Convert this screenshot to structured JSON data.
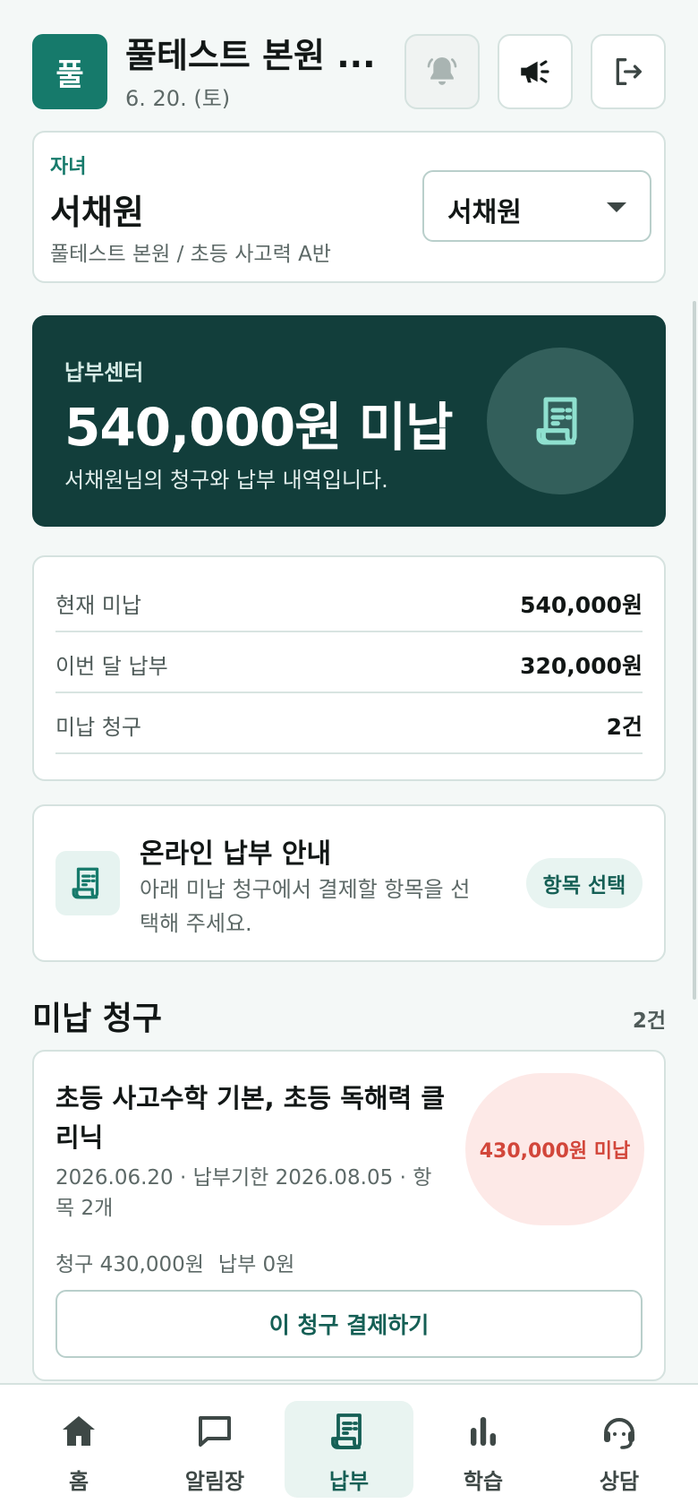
{
  "header": {
    "logo_text": "풀",
    "org_title": "풀테스트 본원 ...",
    "date": "6. 20. (토)"
  },
  "child": {
    "label": "자녀",
    "name": "서채원",
    "subtitle": "풀테스트 본원 / 초등 사고력 A반",
    "selected": "서채원"
  },
  "hero": {
    "label": "납부센터",
    "amount": "540,000원 미납",
    "description": "서채원님의 청구와 납부 내역입니다."
  },
  "summary": [
    {
      "key": "현재 미납",
      "value": "540,000원"
    },
    {
      "key": "이번 달 납부",
      "value": "320,000원"
    },
    {
      "key": "미납 청구",
      "value": "2건"
    }
  ],
  "info": {
    "title": "온라인 납부 안내",
    "description": "아래 미납 청구에서 결제할 항목을 선택해 주세요.",
    "chip": "항목 선택"
  },
  "section": {
    "title": "미납 청구",
    "count": "2건"
  },
  "invoice": {
    "title": "초등 사고수학 기본, 초등 독해력 클리닉",
    "meta": "2026.06.20 · 납부기한 2026.08.05 · 항목 2개",
    "billed": "청구 430,000원",
    "paid": "납부 0원",
    "badge": "430,000원 미납",
    "pay_button": "이 청구 결제하기"
  },
  "nav": [
    {
      "label": "홈",
      "icon": "home-icon",
      "active": false
    },
    {
      "label": "알림장",
      "icon": "message-icon",
      "active": false
    },
    {
      "label": "납부",
      "icon": "receipt-icon",
      "active": true
    },
    {
      "label": "학습",
      "icon": "chart-icon",
      "active": false
    },
    {
      "label": "상담",
      "icon": "headset-icon",
      "active": false
    }
  ],
  "colors": {
    "brand": "#167a6b",
    "hero_bg": "#123e3b",
    "danger": "#d2463a",
    "accent_mint": "#8fe0cf"
  }
}
